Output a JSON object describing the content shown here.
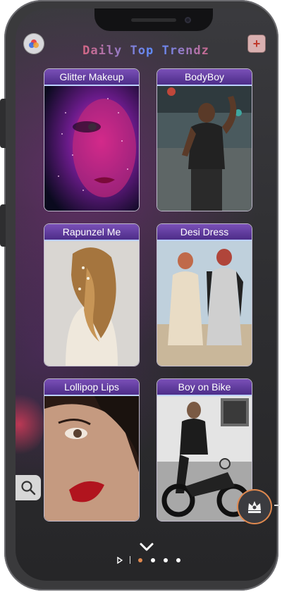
{
  "app": {
    "title": "Daily Top Trendz"
  },
  "toolbar": {
    "logo_icon": "circle-logo-icon",
    "add_icon": "plus-icon",
    "add_label": "+"
  },
  "cards": [
    {
      "label": "Glitter Makeup"
    },
    {
      "label": "BodyBoy"
    },
    {
      "label": "Rapunzel Me"
    },
    {
      "label": "Desi Dress"
    },
    {
      "label": "Lollipop Lips"
    },
    {
      "label": "Boy on Bike"
    }
  ],
  "controls": {
    "search_icon": "search-icon",
    "crown_icon": "crown-icon",
    "chevron_icon": "chevron-down-icon"
  },
  "pager": {
    "pages": 4,
    "active_index": 0
  },
  "colors": {
    "accent": "#e0894f",
    "card_header": "#5b3a99",
    "title_gradient": [
      "#ff5a5a",
      "#5a8cff"
    ]
  }
}
